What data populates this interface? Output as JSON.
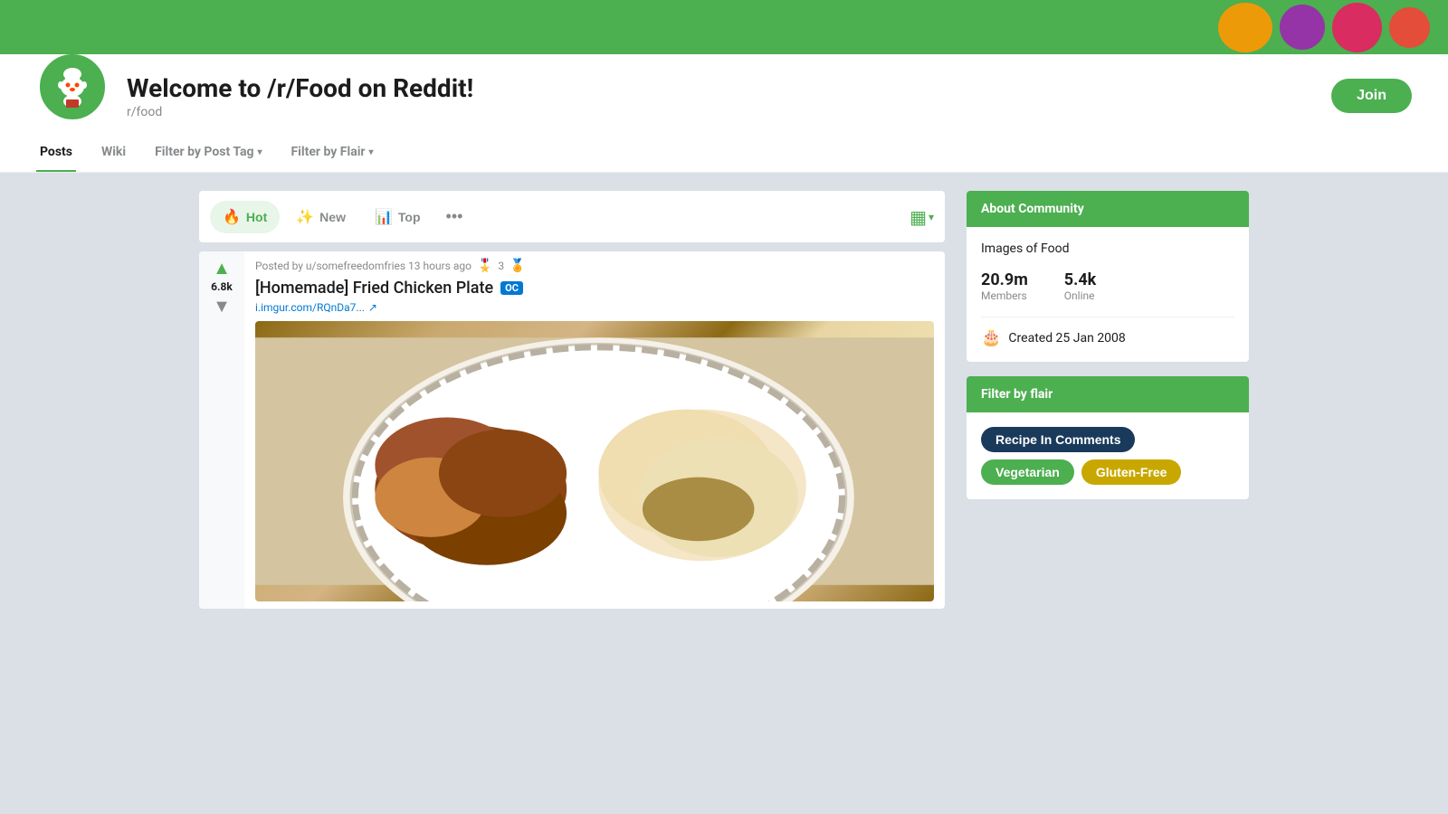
{
  "banner": {
    "bg_color": "#4CAF50"
  },
  "header": {
    "title": "Welcome to /r/Food on Reddit!",
    "subreddit": "r/food",
    "join_label": "Join"
  },
  "nav": {
    "items": [
      {
        "id": "posts",
        "label": "Posts",
        "active": true
      },
      {
        "id": "wiki",
        "label": "Wiki",
        "active": false
      },
      {
        "id": "filter-tag",
        "label": "Filter by Post Tag",
        "dropdown": true,
        "active": false
      },
      {
        "id": "filter-flair",
        "label": "Filter by Flair",
        "dropdown": true,
        "active": false
      }
    ]
  },
  "sort": {
    "options": [
      {
        "id": "hot",
        "label": "Hot",
        "icon": "🔥",
        "active": true
      },
      {
        "id": "new",
        "label": "New",
        "icon": "✨",
        "active": false
      },
      {
        "id": "top",
        "label": "Top",
        "icon": "📊",
        "active": false
      }
    ],
    "more_label": "•••",
    "layout_icon": "▦"
  },
  "post": {
    "meta": "Posted by u/somefreedomfries 13 hours ago",
    "award_count": "3",
    "title": "[Homemade] Fried Chicken Plate",
    "oc_badge": "OC",
    "link": "i.imgur.com/RQnDa7...",
    "vote_count": "6.8k",
    "vote_up_symbol": "▲",
    "vote_down_symbol": "▼"
  },
  "sidebar": {
    "about": {
      "header": "About Community",
      "description": "Images of Food",
      "members_count": "20.9m",
      "members_label": "Members",
      "online_count": "5.4k",
      "online_label": "Online",
      "created_label": "Created 25 Jan 2008"
    },
    "filter_flair": {
      "header": "Filter by flair",
      "tags": [
        {
          "id": "recipe-comments",
          "label": "Recipe In Comments",
          "style": "dark-blue"
        },
        {
          "id": "vegetarian",
          "label": "Vegetarian",
          "style": "green"
        },
        {
          "id": "gluten-free",
          "label": "Gluten-Free",
          "style": "gold"
        }
      ]
    }
  }
}
